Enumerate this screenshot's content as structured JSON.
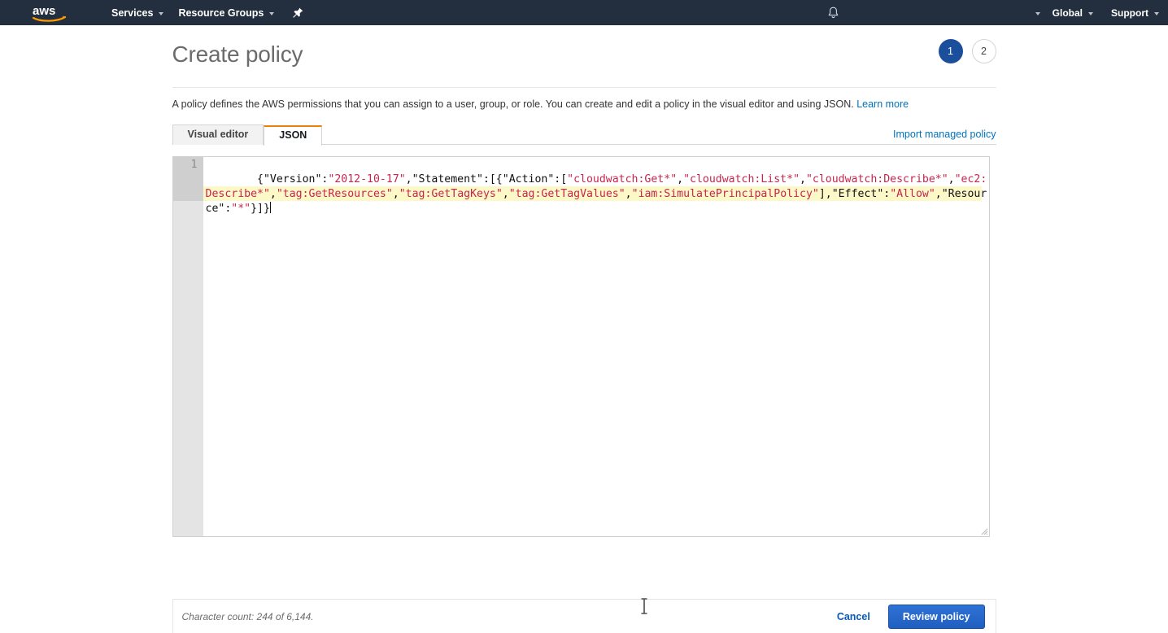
{
  "navbar": {
    "logo_alt": "aws",
    "services_label": "Services",
    "resource_groups_label": "Resource Groups",
    "pin_icon": "pin-icon",
    "bell_icon": "bell-icon",
    "account_label": "",
    "region_label": "Global",
    "support_label": "Support"
  },
  "header": {
    "title": "Create policy",
    "steps": [
      {
        "number": "1",
        "state": "active"
      },
      {
        "number": "2",
        "state": "inactive"
      }
    ]
  },
  "description": {
    "text": "A policy defines the AWS permissions that you can assign to a user, group, or role. You can create and edit a policy in the visual editor and using JSON.",
    "link_label": "Learn more"
  },
  "tabs": {
    "items": [
      {
        "label": "Visual editor",
        "active": false
      },
      {
        "label": "JSON",
        "active": true
      }
    ],
    "import_link_label": "Import managed policy"
  },
  "editor": {
    "line_number": "1",
    "code": "{\"Version\":\"2012-10-17\",\"Statement\":[{\"Action\":[\"cloudwatch:Get*\",\"cloudwatch:List*\",\"cloudwatch:Describe*\",\"ec2:Describe*\",\"tag:GetResources\",\"tag:GetTagKeys\",\"tag:GetTagValues\",\"iam:SimulatePrincipalPolicy\"],\"Effect\":\"Allow\",\"Resource\":\"*\"}]}",
    "segments": [
      {
        "t": "{\"Version\":",
        "k": "p"
      },
      {
        "t": "\"2012-10-17\"",
        "k": "s"
      },
      {
        "t": ",\"Statement\":[{\"Action\":[",
        "k": "p"
      },
      {
        "t": "\"cloudwatch:Get*\"",
        "k": "s"
      },
      {
        "t": ",",
        "k": "p"
      },
      {
        "t": "\"cloudwatch:List*\"",
        "k": "s"
      },
      {
        "t": ",",
        "k": "p"
      },
      {
        "t": "\"cloudwatch:Describe*\"",
        "k": "s"
      },
      {
        "t": ",",
        "k": "p"
      },
      {
        "t": "\"ec2:Describe*\"",
        "k": "s"
      },
      {
        "t": ",",
        "k": "p"
      },
      {
        "t": "\"tag:GetResources\"",
        "k": "s"
      },
      {
        "t": ",",
        "k": "p"
      },
      {
        "t": "\"tag:GetTagKeys\"",
        "k": "s"
      },
      {
        "t": ",",
        "k": "p"
      },
      {
        "t": "\"tag:GetTagValues\"",
        "k": "s"
      },
      {
        "t": ",",
        "k": "p"
      },
      {
        "t": "\"iam:SimulatePrincipalPolicy\"",
        "k": "s"
      },
      {
        "t": "],\"Effect\":",
        "k": "p"
      },
      {
        "t": "\"Allow\"",
        "k": "s"
      },
      {
        "t": ",\"Resource\":",
        "k": "p"
      },
      {
        "t": "\"*\"",
        "k": "s"
      },
      {
        "t": "}]}",
        "k": "p"
      }
    ]
  },
  "footer": {
    "character_count": "Character count: 244 of 6,144.",
    "cancel_label": "Cancel",
    "review_label": "Review policy"
  },
  "colors": {
    "navbar_bg": "#232f3e",
    "accent_orange": "#e8820c",
    "link_blue": "#0073bb",
    "primary_button": "#1f5fc0",
    "step_active": "#1b4f9c",
    "json_string": "#c7254e",
    "active_line": "#fdf8c8"
  }
}
